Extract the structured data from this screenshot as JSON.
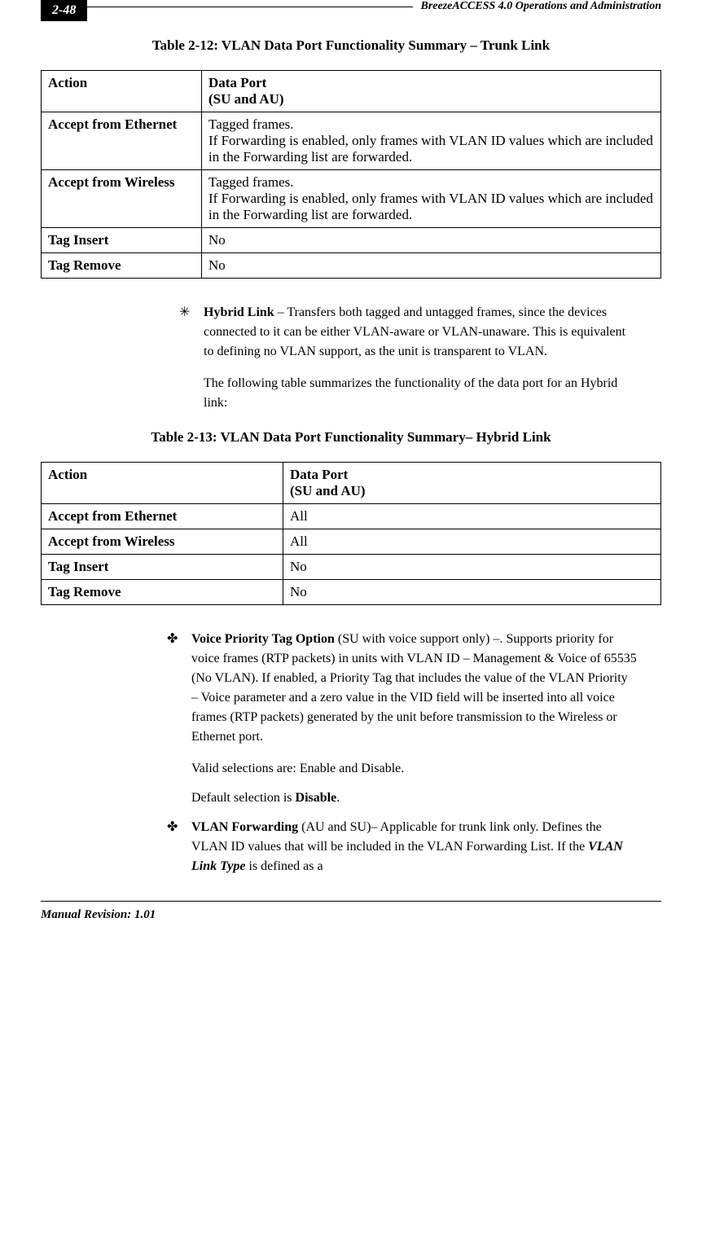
{
  "header": {
    "page_number": "2-48",
    "title": "BreezeACCESS 4.0 Operations and Administration"
  },
  "table1": {
    "caption": "Table 2-12: VLAN Data Port Functionality Summary – Trunk Link",
    "headers": {
      "col1": "Action",
      "col2_line1": "Data Port",
      "col2_line2": " (SU and AU)"
    },
    "rows": [
      {
        "action": "Accept from Ethernet",
        "data_line1": "Tagged frames.",
        "data_line2": "If Forwarding is enabled, only frames with VLAN ID values which are included in the Forwarding list are forwarded."
      },
      {
        "action": "Accept from Wireless",
        "data_line1": "Tagged frames.",
        "data_line2": "If Forwarding is enabled, only frames with VLAN ID values which are included in the Forwarding list are forwarded."
      },
      {
        "action": "Tag Insert",
        "data": "No"
      },
      {
        "action": "Tag Remove",
        "data": "No"
      }
    ]
  },
  "hybrid_bullet": {
    "marker": "✳",
    "title": "Hybrid Link",
    "text": " – Transfers both tagged and untagged frames, since the devices connected to it can be either VLAN-aware or VLAN-unaware. This is equivalent to defining no VLAN support, as the unit is transparent to VLAN."
  },
  "hybrid_para2": "The following table summarizes the functionality of the data port for an Hybrid link:",
  "table2": {
    "caption": "Table 2-13: VLAN Data Port Functionality Summary– Hybrid Link",
    "headers": {
      "col1": "Action",
      "col2_line1": "Data Port",
      "col2_line2": "(SU and AU)"
    },
    "rows": [
      {
        "action": "Accept from Ethernet",
        "data": "All"
      },
      {
        "action": "Accept from Wireless",
        "data": "All"
      },
      {
        "action": "Tag Insert",
        "data": "No"
      },
      {
        "action": "Tag Remove",
        "data": "No"
      }
    ]
  },
  "voice_bullet": {
    "marker": "✤",
    "title": "Voice Priority Tag Option",
    "text": " (SU with voice support only) –. Supports priority for voice frames (RTP packets) in units with VLAN ID – Management & Voice of 65535 (No VLAN). If enabled, a Priority Tag that includes the value of the VLAN Priority – Voice parameter and a zero value in the VID field will be inserted into all voice frames (RTP packets) generated by the unit before transmission to the Wireless or Ethernet port."
  },
  "voice_para2": "Valid selections are: Enable and Disable.",
  "voice_para3_pre": "Default selection is ",
  "voice_para3_bold": "Disable",
  "voice_para3_post": ".",
  "vlan_bullet": {
    "marker": "✤",
    "title": "VLAN Forwarding",
    "text_pre": " (AU and SU)– Applicable for trunk link only. Defines the VLAN ID values that will be included in the VLAN Forwarding List. If the ",
    "text_italic": "VLAN Link Type",
    "text_post": " is defined as a"
  },
  "footer": {
    "text": "Manual Revision: 1.01"
  }
}
